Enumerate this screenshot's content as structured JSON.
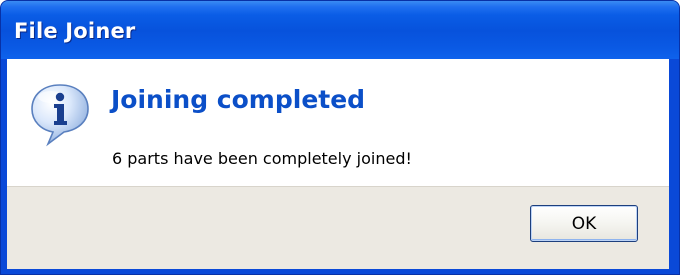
{
  "window": {
    "title": "File Joiner"
  },
  "dialog": {
    "icon": "info-icon",
    "headline": "Joining completed",
    "message": "6 parts have been completely joined!",
    "ok_label": "OK"
  },
  "colors": {
    "titlebar": "#0a59e4",
    "headline": "#0b4fc8",
    "button_area": "#ece9e2"
  }
}
